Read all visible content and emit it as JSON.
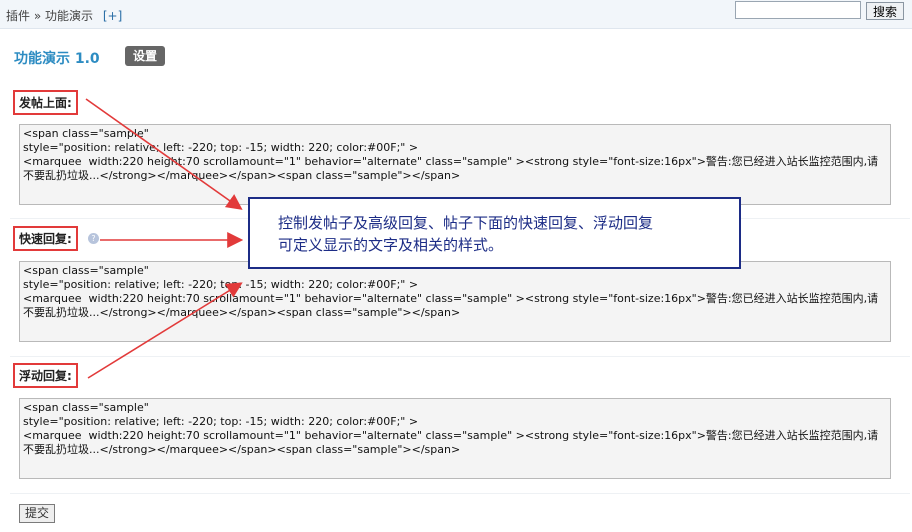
{
  "breadcrumb": {
    "plugins": "插件",
    "sep": "»",
    "current": "功能演示",
    "add": "[+]"
  },
  "search": {
    "value": "",
    "button": "搜索"
  },
  "plugin": {
    "title": "功能演示 1.0",
    "settings": "设置"
  },
  "sections": [
    {
      "label": "发帖上面:",
      "code": "<span class=\"sample\"\nstyle=\"position: relative; left: -220; top: -15; width: 220; color:#00F;\" >\n<marquee  width:220 height:70 scrollamount=\"1\" behavior=\"alternate\" class=\"sample\" ><strong style=\"font-size:16px\">警告:您已经进入站长监控范围内,请不要乱扔垃圾...</strong></marquee></span><span class=\"sample\"></span>"
    },
    {
      "label": "快速回复:",
      "help": "?",
      "code": "<span class=\"sample\"\nstyle=\"position: relative; left: -220; top: -15; width: 220; color:#00F;\" >\n<marquee  width:220 height:70 scrollamount=\"1\" behavior=\"alternate\" class=\"sample\" ><strong style=\"font-size:16px\">警告:您已经进入站长监控范围内,请不要乱扔垃圾...</strong></marquee></span><span class=\"sample\"></span>"
    },
    {
      "label": "浮动回复:",
      "code": "<span class=\"sample\"\nstyle=\"position: relative; left: -220; top: -15; width: 220; color:#00F;\" >\n<marquee  width:220 height:70 scrollamount=\"1\" behavior=\"alternate\" class=\"sample\" ><strong style=\"font-size:16px\">警告:您已经进入站长监控范围内,请不要乱扔垃圾...</strong></marquee></span><span class=\"sample\"></span>"
    }
  ],
  "callout": {
    "line1": "控制发帖子及高级回复、帖子下面的快速回复、浮动回复",
    "line2": "可定义显示的文字及相关的样式。"
  },
  "submit": "提交",
  "colors": {
    "annotation": "#e23a3a",
    "callout": "#1c2c86",
    "title": "#2d8cc2"
  }
}
